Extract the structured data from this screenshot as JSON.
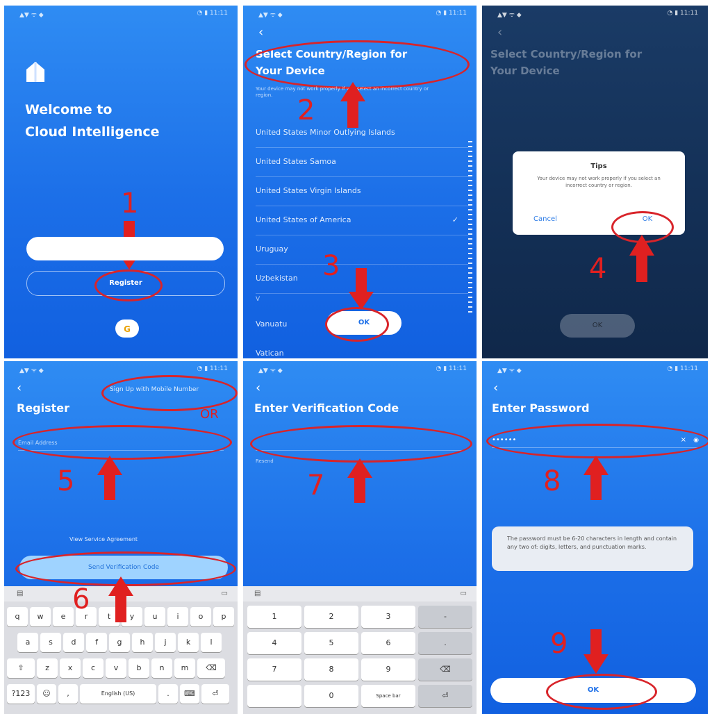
{
  "status": {
    "left": "▲▼ ᯤ ◆",
    "right": "◔ ▮ 11:11"
  },
  "steps": [
    "1",
    "2",
    "3",
    "4",
    "5",
    "6",
    "7",
    "8",
    "9",
    "OR"
  ],
  "p1": {
    "title_line1": "Welcome to",
    "title_line2": "Cloud Intelligence",
    "register_label": "Register",
    "google_glyph": "G"
  },
  "p2": {
    "title_line1": "Select Country/Region for",
    "title_line2": "Your Device",
    "subtitle": "Your device may not work properly if you select an incorrect country or region.",
    "items": [
      "United States Minor Outlying Islands",
      "United States Samoa",
      "United States Virgin Islands",
      "United States of America",
      "Uruguay",
      "Uzbekistan",
      "V",
      "Vanuatu",
      "Vatican"
    ],
    "ok_label": "OK",
    "check": "✓"
  },
  "p3": {
    "title_line1": "Select Country/Region for",
    "title_line2": "Your Device",
    "dialog_title": "Tips",
    "dialog_text": "Your device may not work properly if you select an incorrect country or region.",
    "cancel_label": "Cancel",
    "ok_label": "OK",
    "bottom_ok": "OK"
  },
  "p4": {
    "title": "Register",
    "top_link": "Sign Up with Mobile Number",
    "email_placeholder": "Email Address",
    "service_text": "View Service Agreement",
    "send_label": "Send Verification Code",
    "kbd_rows": [
      [
        "q",
        "w",
        "e",
        "r",
        "t",
        "y",
        "u",
        "i",
        "o",
        "p"
      ],
      [
        "a",
        "s",
        "d",
        "f",
        "g",
        "h",
        "j",
        "k",
        "l"
      ],
      [
        "⇧",
        "z",
        "x",
        "c",
        "v",
        "b",
        "n",
        "m",
        "⌫"
      ],
      [
        "?123",
        "☺",
        ",",
        "English (US)",
        ".",
        "⌨",
        "⏎"
      ]
    ]
  },
  "p5": {
    "title": "Enter Verification Code",
    "resend": "Resend",
    "keys": [
      "1",
      "2",
      "3",
      "-",
      "4",
      "5",
      "6",
      ".",
      "7",
      "8",
      "9",
      "⌫",
      "",
      "0",
      "Space bar",
      "⏎"
    ]
  },
  "p6": {
    "title": "Enter Password",
    "password_value": "••••••",
    "hint": "The password must be 6-20 characters in length and contain any two of: digits, letters, and punctuation marks.",
    "ok_label": "OK",
    "clear_icon": "×",
    "eye_icon": "👁"
  }
}
